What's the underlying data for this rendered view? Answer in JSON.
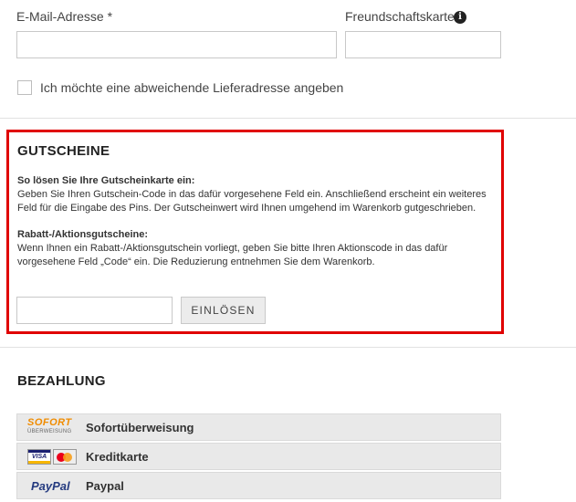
{
  "form": {
    "email_label": "E-Mail-Adresse *",
    "friend_label": "Freundschaftskarte",
    "info_icon": "info-icon",
    "delivery_checkbox_label": "Ich möchte eine abweichende Lieferadresse angeben"
  },
  "voucher": {
    "title": "GUTSCHEINE",
    "gift_heading": "So lösen Sie Ihre Gutscheinkarte ein:",
    "gift_line1": "Geben Sie Ihren Gutschein-Code in das dafür vorgesehene Feld ein. Anschließend erscheint ein weiteres",
    "gift_line2": "Feld für die Eingabe des Pins. Der Gutscheinwert wird Ihnen umgehend im Warenkorb gutgeschrieben.",
    "promo_heading": "Rabatt-/Aktionsgutscheine:",
    "promo_line1": "Wenn Ihnen ein Rabatt-/Aktionsgutschein vorliegt, geben Sie bitte Ihren Aktionscode in das dafür",
    "promo_line2": "vorgesehene Feld „Code“ ein. Die Reduzierung entnehmen Sie dem Warenkorb.",
    "redeem_button": "EINLÖSEN",
    "highlight_color": "#e00000"
  },
  "payment": {
    "title": "BEZAHLUNG",
    "methods": [
      {
        "label": "Sofortüberweisung",
        "logo_text": "SOFORT",
        "logo_sub": "ÜBERWEISUNG",
        "logo_color": "#f08c00"
      },
      {
        "label": "Kreditkarte",
        "logo_text": "VISA",
        "icon": "credit-card-icon"
      },
      {
        "label": "Paypal",
        "logo_text": "PayPal",
        "logo_color": "#253b80"
      }
    ]
  }
}
